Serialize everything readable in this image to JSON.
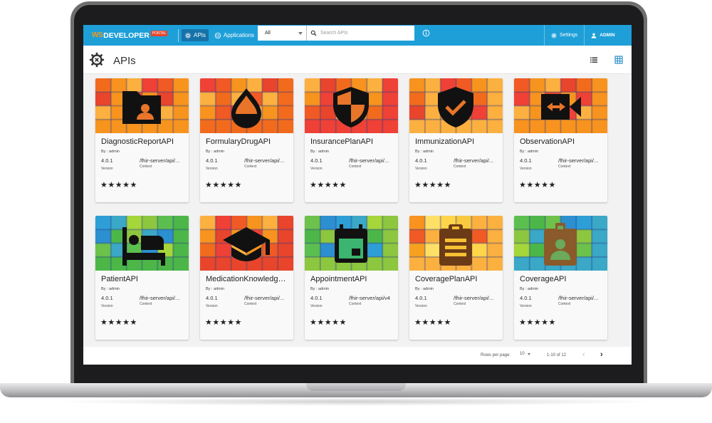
{
  "appbar": {
    "logo_prefix": "WS",
    "logo_title": "DEVELOPER",
    "logo_badge": "PORTAL",
    "nav": [
      {
        "label": "APIs",
        "icon": "gear-icon",
        "active": true
      },
      {
        "label": "Applications",
        "icon": "applications-icon",
        "active": false
      }
    ],
    "search_filter": "All",
    "search_placeholder": "Search APIs",
    "settings_label": "Settings",
    "user_label": "ADMIN"
  },
  "page": {
    "title": "APIs"
  },
  "cards": [
    {
      "name": "DiagnosticReportAPI",
      "by": "By : admin",
      "version": "4.0.1",
      "version_label": "Version",
      "context": "/fhir-server/api/...",
      "context_label": "Context",
      "stars": "★★★★★",
      "icon": "folder-user-icon",
      "theme": "orange"
    },
    {
      "name": "FormularyDrugAPI",
      "by": "By : admin",
      "version": "4.0.1",
      "version_label": "Version",
      "context": "/fhir-server/api/...",
      "context_label": "Context",
      "stars": "★★★★★",
      "icon": "drop-icon",
      "theme": "orange"
    },
    {
      "name": "InsurancePlanAPI",
      "by": "By : admin",
      "version": "4.0.1",
      "version_label": "Version",
      "context": "/fhir-server/api/...",
      "context_label": "Context",
      "stars": "★★★★★",
      "icon": "shield-half-icon",
      "theme": "orange"
    },
    {
      "name": "ImmunizationAPI",
      "by": "By : admin",
      "version": "4.0.1",
      "version_label": "Version",
      "context": "/fhir-server/api/...",
      "context_label": "Context",
      "stars": "★★★★★",
      "icon": "shield-check-icon",
      "theme": "orange"
    },
    {
      "name": "ObservationAPI",
      "by": "By : admin",
      "version": "4.0.1",
      "version_label": "Version",
      "context": "/fhir-server/api/...",
      "context_label": "Context",
      "stars": "★★★★★",
      "icon": "video-arrows-icon",
      "theme": "orange"
    },
    {
      "name": "PatientAPI",
      "by": "By : admin",
      "version": "4.0.1",
      "version_label": "Version",
      "context": "/fhir-server/api/...",
      "context_label": "Context",
      "stars": "★★★★★",
      "icon": "hotel-bed-icon",
      "theme": "green"
    },
    {
      "name": "MedicationKnowledgeAPI",
      "by": "By : admin",
      "version": "4.0.1",
      "version_label": "Version",
      "context": "/fhir-server/api/...",
      "context_label": "Context",
      "stars": "★★★★★",
      "icon": "graduation-cap-icon",
      "theme": "orange"
    },
    {
      "name": "AppointmentAPI",
      "by": "By : admin",
      "version": "4.0.1",
      "version_label": "Version",
      "context": "/fhir-server/api/v4",
      "context_label": "Context",
      "stars": "★★★★★",
      "icon": "calendar-icon",
      "theme": "green"
    },
    {
      "name": "CoveragePlanAPI",
      "by": "By : admin",
      "version": "4.0.1",
      "version_label": "Version",
      "context": "/fhir-server/api/...",
      "context_label": "Context",
      "stars": "★★★★★",
      "icon": "clipboard-icon",
      "theme": "yellow"
    },
    {
      "name": "CoverageAPI",
      "by": "By : admin",
      "version": "4.0.1",
      "version_label": "Version",
      "context": "/fhir-server/api/...",
      "context_label": "Context",
      "stars": "★★★★★",
      "icon": "id-badge-icon",
      "theme": "green"
    }
  ],
  "pager": {
    "rows_label": "Rows per page:",
    "rows_value": "10",
    "range": "1-10 of 12",
    "prev": "‹",
    "next": "›"
  }
}
